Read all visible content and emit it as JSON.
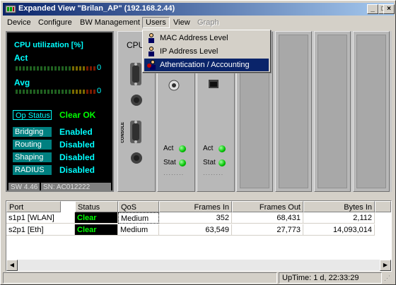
{
  "window": {
    "title": "Expanded View \"Brilan_AP\" (192.168.2.44)"
  },
  "menubar": {
    "device": "Device",
    "configure": "Configure",
    "bw_management": "BW Management",
    "users": "Users",
    "view": "View",
    "graph": "Graph"
  },
  "users_menu": {
    "items": [
      {
        "label": "MAC Address Level"
      },
      {
        "label": "IP Address Level"
      },
      {
        "label": "Athentication / Accounting"
      }
    ]
  },
  "front_panel": {
    "cpu_title": "CPU utilization [%]",
    "act_label": "Act",
    "act_value": "0",
    "avg_label": "Avg",
    "avg_value": "0",
    "op_status_label": "Op Status",
    "op_status_value": "Clear OK",
    "bridging_label": "Bridging",
    "bridging_value": "Enabled",
    "routing_label": "Routing",
    "routing_value": "Disabled",
    "shaping_label": "Shaping",
    "shaping_value": "Disabled",
    "radius_label": "RADIUS",
    "radius_value": "Disabled",
    "sw_version": "SW 4.46",
    "serial": "SN: AC012222"
  },
  "slots": {
    "cpu_label": "CPU",
    "console_label": "CONSOLE",
    "act_label": "Act",
    "stat_label": "Stat"
  },
  "table": {
    "headers": {
      "port": "Port",
      "status": "Status",
      "qos": "QoS",
      "frames_in": "Frames In",
      "frames_out": "Frames Out",
      "bytes_in": "Bytes In"
    },
    "rows": [
      {
        "port": "s1p1  [WLAN]",
        "status": "Clear",
        "qos": "Medium",
        "frames_in": "352",
        "frames_out": "68,431",
        "bytes_in": "2,112"
      },
      {
        "port": "s2p1  [Eth]",
        "status": "Clear",
        "qos": "Medium",
        "frames_in": "63,549",
        "frames_out": "27,773",
        "bytes_in": "14,093,014"
      }
    ]
  },
  "statusbar": {
    "uptime": "UpTime:  1 d, 22:33:29"
  },
  "colors": {
    "titlebar": "#0a246a",
    "highlight": "#0a246a",
    "led_green": "#00c000",
    "clear_text": "#00ff00",
    "panel_cyan": "#00ffff"
  }
}
